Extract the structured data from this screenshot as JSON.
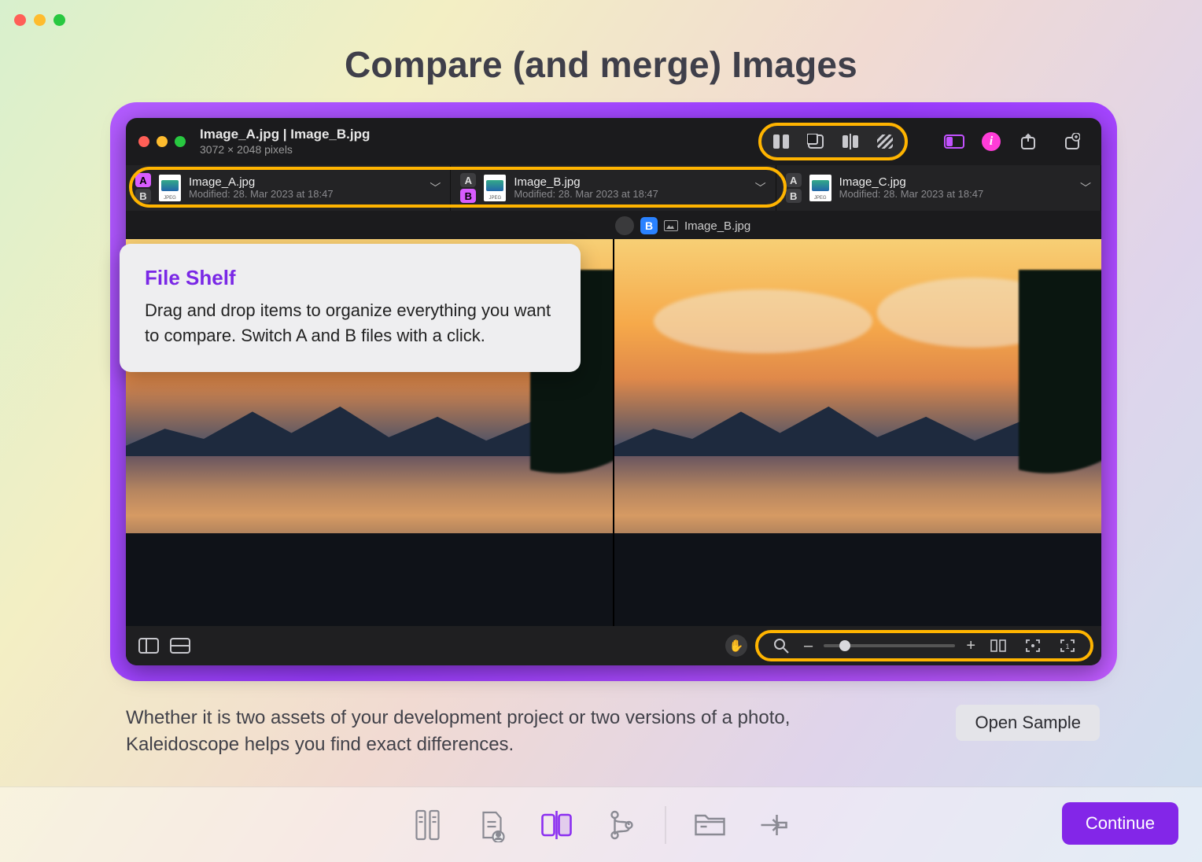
{
  "title": "Compare (and merge) Images",
  "app": {
    "window_title": "Image_A.jpg | Image_B.jpg",
    "dimensions": "3072 × 2048 pixels",
    "shelf": [
      {
        "name": "Image_A.jpg",
        "modified": "Modified: 28. Mar 2023 at 18:47",
        "selected": "A"
      },
      {
        "name": "Image_B.jpg",
        "modified": "Modified: 28. Mar 2023 at 18:47",
        "selected": "B"
      },
      {
        "name": "Image_C.jpg",
        "modified": "Modified: 28. Mar 2023 at 18:47",
        "selected": ""
      }
    ],
    "crumb_badge": "B",
    "crumb_file": "Image_B.jpg"
  },
  "callout": {
    "heading": "File Shelf",
    "body": "Drag and drop items to organize everything you want to compare. Switch A and B files with a click."
  },
  "description": "Whether it is two assets of your development project or two versions of a photo, Kaleidoscope helps you find exact differences.",
  "buttons": {
    "open_sample": "Open Sample",
    "continue": "Continue"
  },
  "zoom": {
    "minus": "–",
    "plus": "+"
  }
}
